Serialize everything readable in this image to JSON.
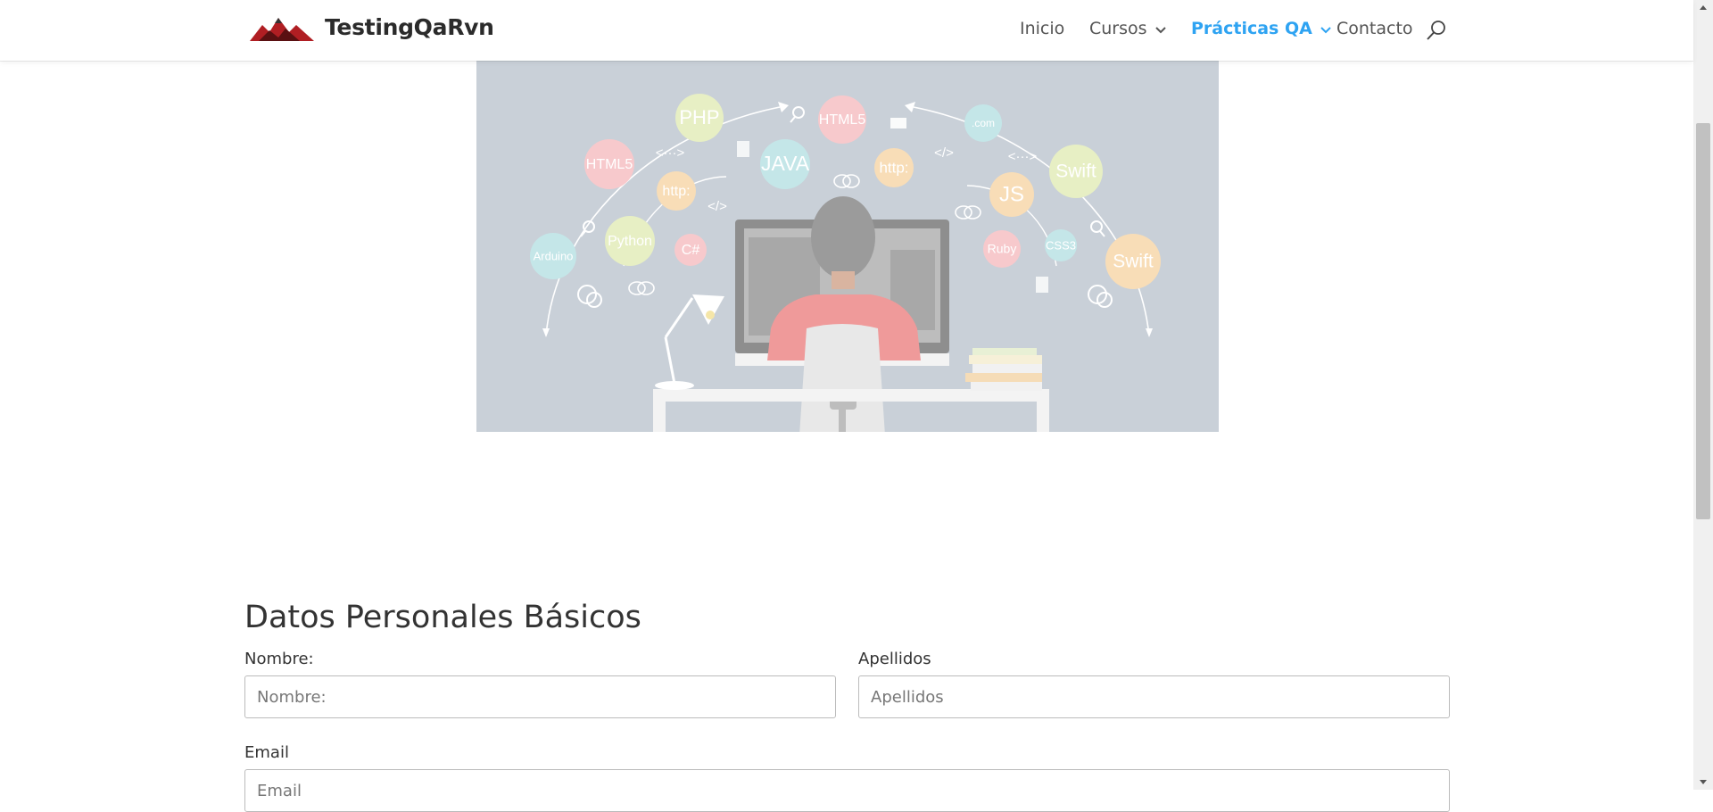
{
  "brand": {
    "name": "TestingQaRvn"
  },
  "nav": {
    "items": [
      {
        "label": "Inicio"
      },
      {
        "label": "Cursos"
      },
      {
        "label": "Prácticas QA"
      },
      {
        "label": "Contacto"
      }
    ]
  },
  "hero": {
    "bubbles": [
      "PHP",
      "HTML5",
      ".com",
      "HTML5",
      "JAVA",
      "http:",
      "Swift",
      "http:",
      "JS",
      "Arduino",
      "Python",
      "C#",
      "Ruby",
      "CSS3",
      "Swift"
    ],
    "code_marks": [
      "<···>",
      "</>",
      "</>",
      "<···>",
      "</>"
    ]
  },
  "form": {
    "title": "Datos Personales Básicos",
    "nombre": {
      "label": "Nombre:",
      "placeholder": "Nombre:"
    },
    "apellidos": {
      "label": "Apellidos",
      "placeholder": "Apellidos"
    },
    "email": {
      "label": "Email",
      "placeholder": "Email"
    }
  },
  "colors": {
    "accent": "#2ea3f2",
    "logo_mountain": "#b01e23",
    "hero_bg": "#c9d0d8"
  }
}
